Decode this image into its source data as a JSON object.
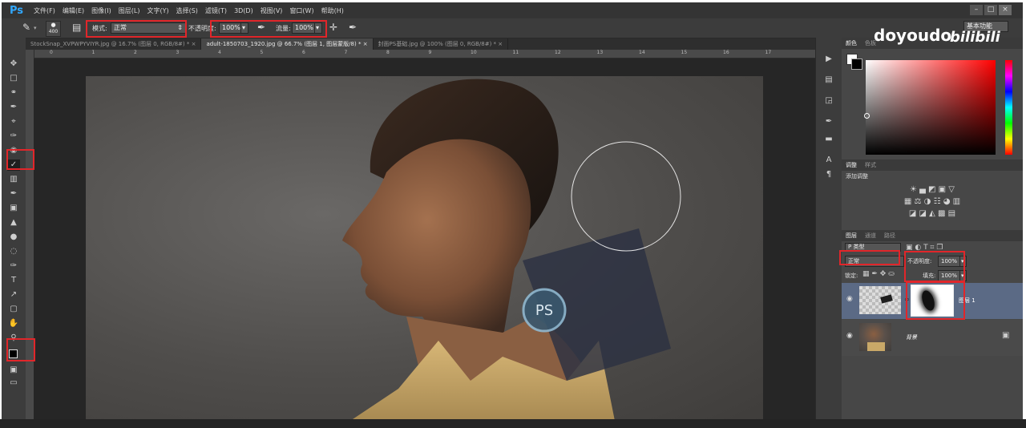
{
  "app": {
    "logo": "Ps",
    "window_buttons": [
      "–",
      "□",
      "×"
    ]
  },
  "menu": [
    "文件(F)",
    "编辑(E)",
    "图像(I)",
    "图层(L)",
    "文字(Y)",
    "选择(S)",
    "滤镜(T)",
    "3D(D)",
    "视图(V)",
    "窗口(W)",
    "帮助(H)"
  ],
  "options": {
    "brush_size": "400",
    "mode_label": "模式:",
    "mode_value": "正常",
    "opacity_label": "不透明度:",
    "opacity_value": "100%",
    "flow_label": "流量:",
    "flow_value": "100%",
    "workspace": "基本功能"
  },
  "tabs": [
    {
      "label": "StockSnap_XVPWPYVIYR.jpg @ 16.7% (图层 0, RGB/8#) *",
      "close": "×"
    },
    {
      "label": "adult-1850703_1920.jpg @ 66.7% (图层 1, 图层蒙版/8) *",
      "close": "×"
    },
    {
      "label": "封面PS基础.jpg @ 100% (图层 0, RGB/8#) *",
      "close": "×"
    }
  ],
  "ruler_ticks": [
    "0",
    "1",
    "2",
    "3",
    "4",
    "5",
    "6",
    "7",
    "8",
    "9",
    "10",
    "11",
    "12",
    "13",
    "14",
    "15",
    "16",
    "17"
  ],
  "canvas": {
    "watermark": "PS"
  },
  "brand": {
    "name": "doyoudo",
    "bili": "bilibili"
  },
  "color_panel": {
    "tabs": [
      "颜色",
      "色板"
    ]
  },
  "adjust_panel": {
    "tabs": [
      "调整",
      "样式"
    ],
    "add_label": "添加调整",
    "icons_row1": "☀ ▄ ◩ ▣ ▽",
    "icons_row2": "▦ ⚖ ◑ ☷ ◕ ▥",
    "icons_row3": "◪ ◪ ◭ ▩ ▤"
  },
  "layers_panel": {
    "tabs": [
      "图层",
      "通道",
      "路径"
    ],
    "filter": "P 类型",
    "filter_icons": "▣ ◐ T ⌗ ❐",
    "blend_mode": "正常",
    "opacity_label": "不透明度:",
    "opacity_value": "100%",
    "lock_label": "锁定:",
    "fill_label": "填充:",
    "fill_value": "100%",
    "layers": [
      {
        "name": "图层 1",
        "visible": "◉",
        "selected": true
      },
      {
        "name": "背景",
        "visible": "◉",
        "selected": false
      }
    ]
  },
  "colors": {
    "accent": "#31a8ff",
    "highlight": "#e1262a",
    "selected_layer": "#5b6a85"
  }
}
